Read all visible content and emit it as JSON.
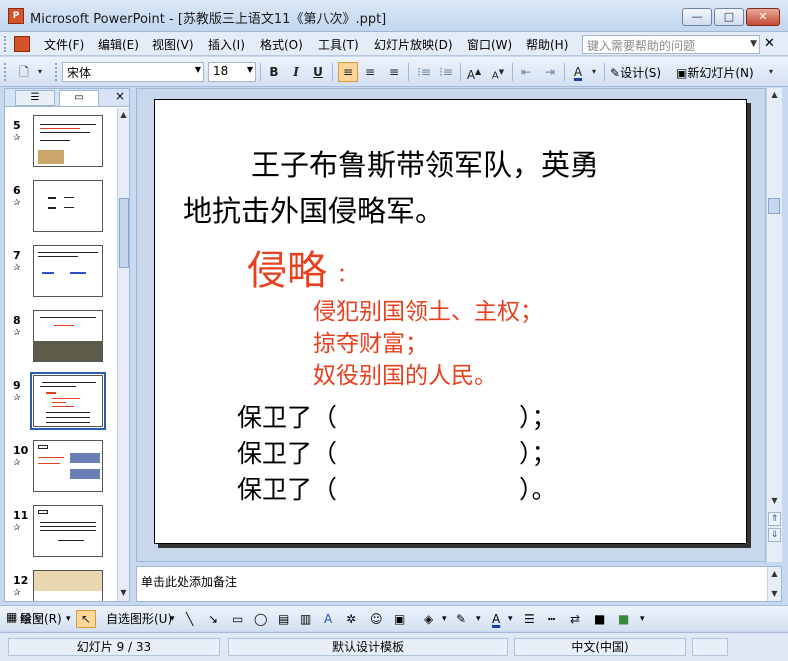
{
  "window": {
    "title": "Microsoft PowerPoint - [苏教版三上语文11《第八次》.ppt]",
    "app_icon_letter": "P",
    "minimize": "—",
    "maximize": "□",
    "close": "✕"
  },
  "menubar": {
    "items": [
      "文件(F)",
      "编辑(E)",
      "视图(V)",
      "插入(I)",
      "格式(O)",
      "工具(T)",
      "幻灯片放映(D)",
      "窗口(W)",
      "帮助(H)"
    ],
    "help_placeholder": "键入需要帮助的问题",
    "close": "✕"
  },
  "toolbar": {
    "font": "宋体",
    "size": "18",
    "bold": "B",
    "italic": "I",
    "underline": "U",
    "design_label": "设计(S)",
    "new_slide_label": "新幻灯片(N)"
  },
  "left_pane": {
    "close": "×",
    "slides": [
      {
        "number": "5"
      },
      {
        "number": "6"
      },
      {
        "number": "7"
      },
      {
        "number": "8"
      },
      {
        "number": "9"
      },
      {
        "number": "10"
      },
      {
        "number": "11"
      },
      {
        "number": "12"
      }
    ],
    "selected": "9"
  },
  "slide": {
    "line1": "王子布鲁斯带领军队，英勇",
    "line2": "地抗击外国侵略军。",
    "term": "侵略",
    "term_colon": "：",
    "definitions": [
      "侵犯别国领土、主权；",
      "掠夺财富；",
      "奴役别国的人民。"
    ],
    "fill_blanks": [
      {
        "prefix": "保卫了（",
        "suffix": "）；"
      },
      {
        "prefix": "保卫了（",
        "suffix": "）；"
      },
      {
        "prefix": "保卫了（",
        "suffix": "）。"
      }
    ]
  },
  "notes": {
    "placeholder": "单击此处添加备注"
  },
  "drawbar": {
    "draw_label": "绘图(R)",
    "autoshape_label": "自选图形(U)"
  },
  "statusbar": {
    "slide_counter": "幻灯片 9 / 33",
    "template": "默认设计模板",
    "language": "中文(中国)"
  },
  "colors": {
    "accent_red": "#e8401e",
    "selection_blue": "#2f5fa8",
    "chrome_blue": "#c7d9f1"
  }
}
